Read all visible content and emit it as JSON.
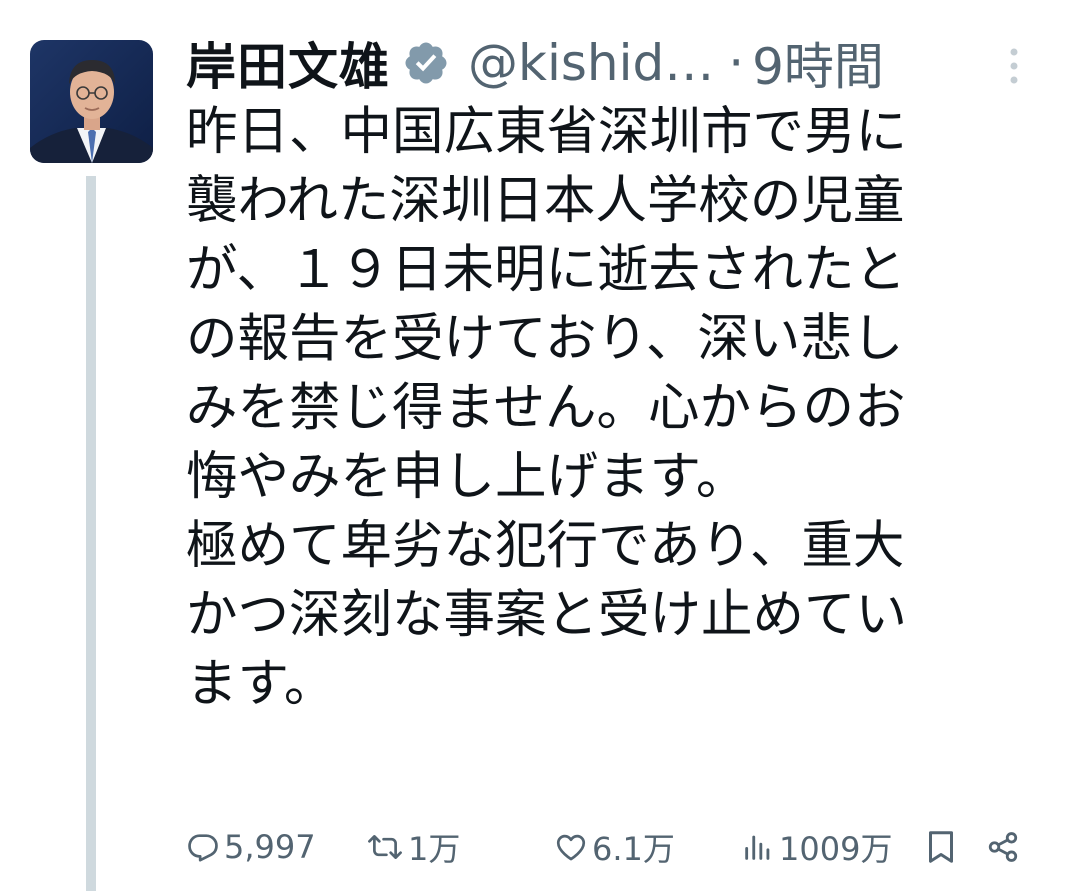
{
  "author": {
    "display_name": "岸田文雄",
    "handle": "@kishid…",
    "separator": "·",
    "time": "9時間"
  },
  "tweet": {
    "text": "昨日、中国広東省深圳市で男に\n襲われた深圳日本人学校の児童\nが、１９日未明に逝去されたと\nの報告を受けており、深い悲し\nみを禁じ得ません。心からのお\n悔やみを申し上げます。\n極めて卑劣な犯行であり、重大\nかつ深刻な事案と受け止めてい\nます。"
  },
  "stats": {
    "replies": "5,997",
    "reposts": "1万",
    "likes": "6.1万",
    "views": "1009万"
  },
  "icons": {
    "verified": "verified-badge-icon",
    "more": "more-options-icon",
    "reply": "reply-icon",
    "repost": "repost-icon",
    "like": "heart-icon",
    "views": "views-icon",
    "bookmark": "bookmark-icon",
    "share": "share-icon"
  },
  "colors": {
    "text": "#0f1419",
    "secondary": "#536471",
    "thread_line": "#cfd9de",
    "verified_badge": "#829aab"
  }
}
